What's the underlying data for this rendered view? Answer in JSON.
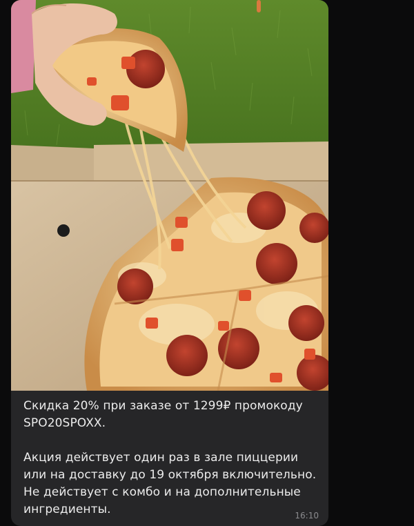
{
  "message": {
    "caption_line1": "Скидка 20% при заказе от 1299₽ промокоду SPO20SPOXX.",
    "caption_line2": "Акция действует один раз в зале пиццерии или на доставку до 19 октября включительно. Не действует с комбо и на дополнительные ингредиенты.",
    "time": "16:10"
  },
  "colors": {
    "bubble": "#262628",
    "background": "#0b0b0c",
    "text": "#ececec",
    "timestamp": "#8b8b8e"
  }
}
